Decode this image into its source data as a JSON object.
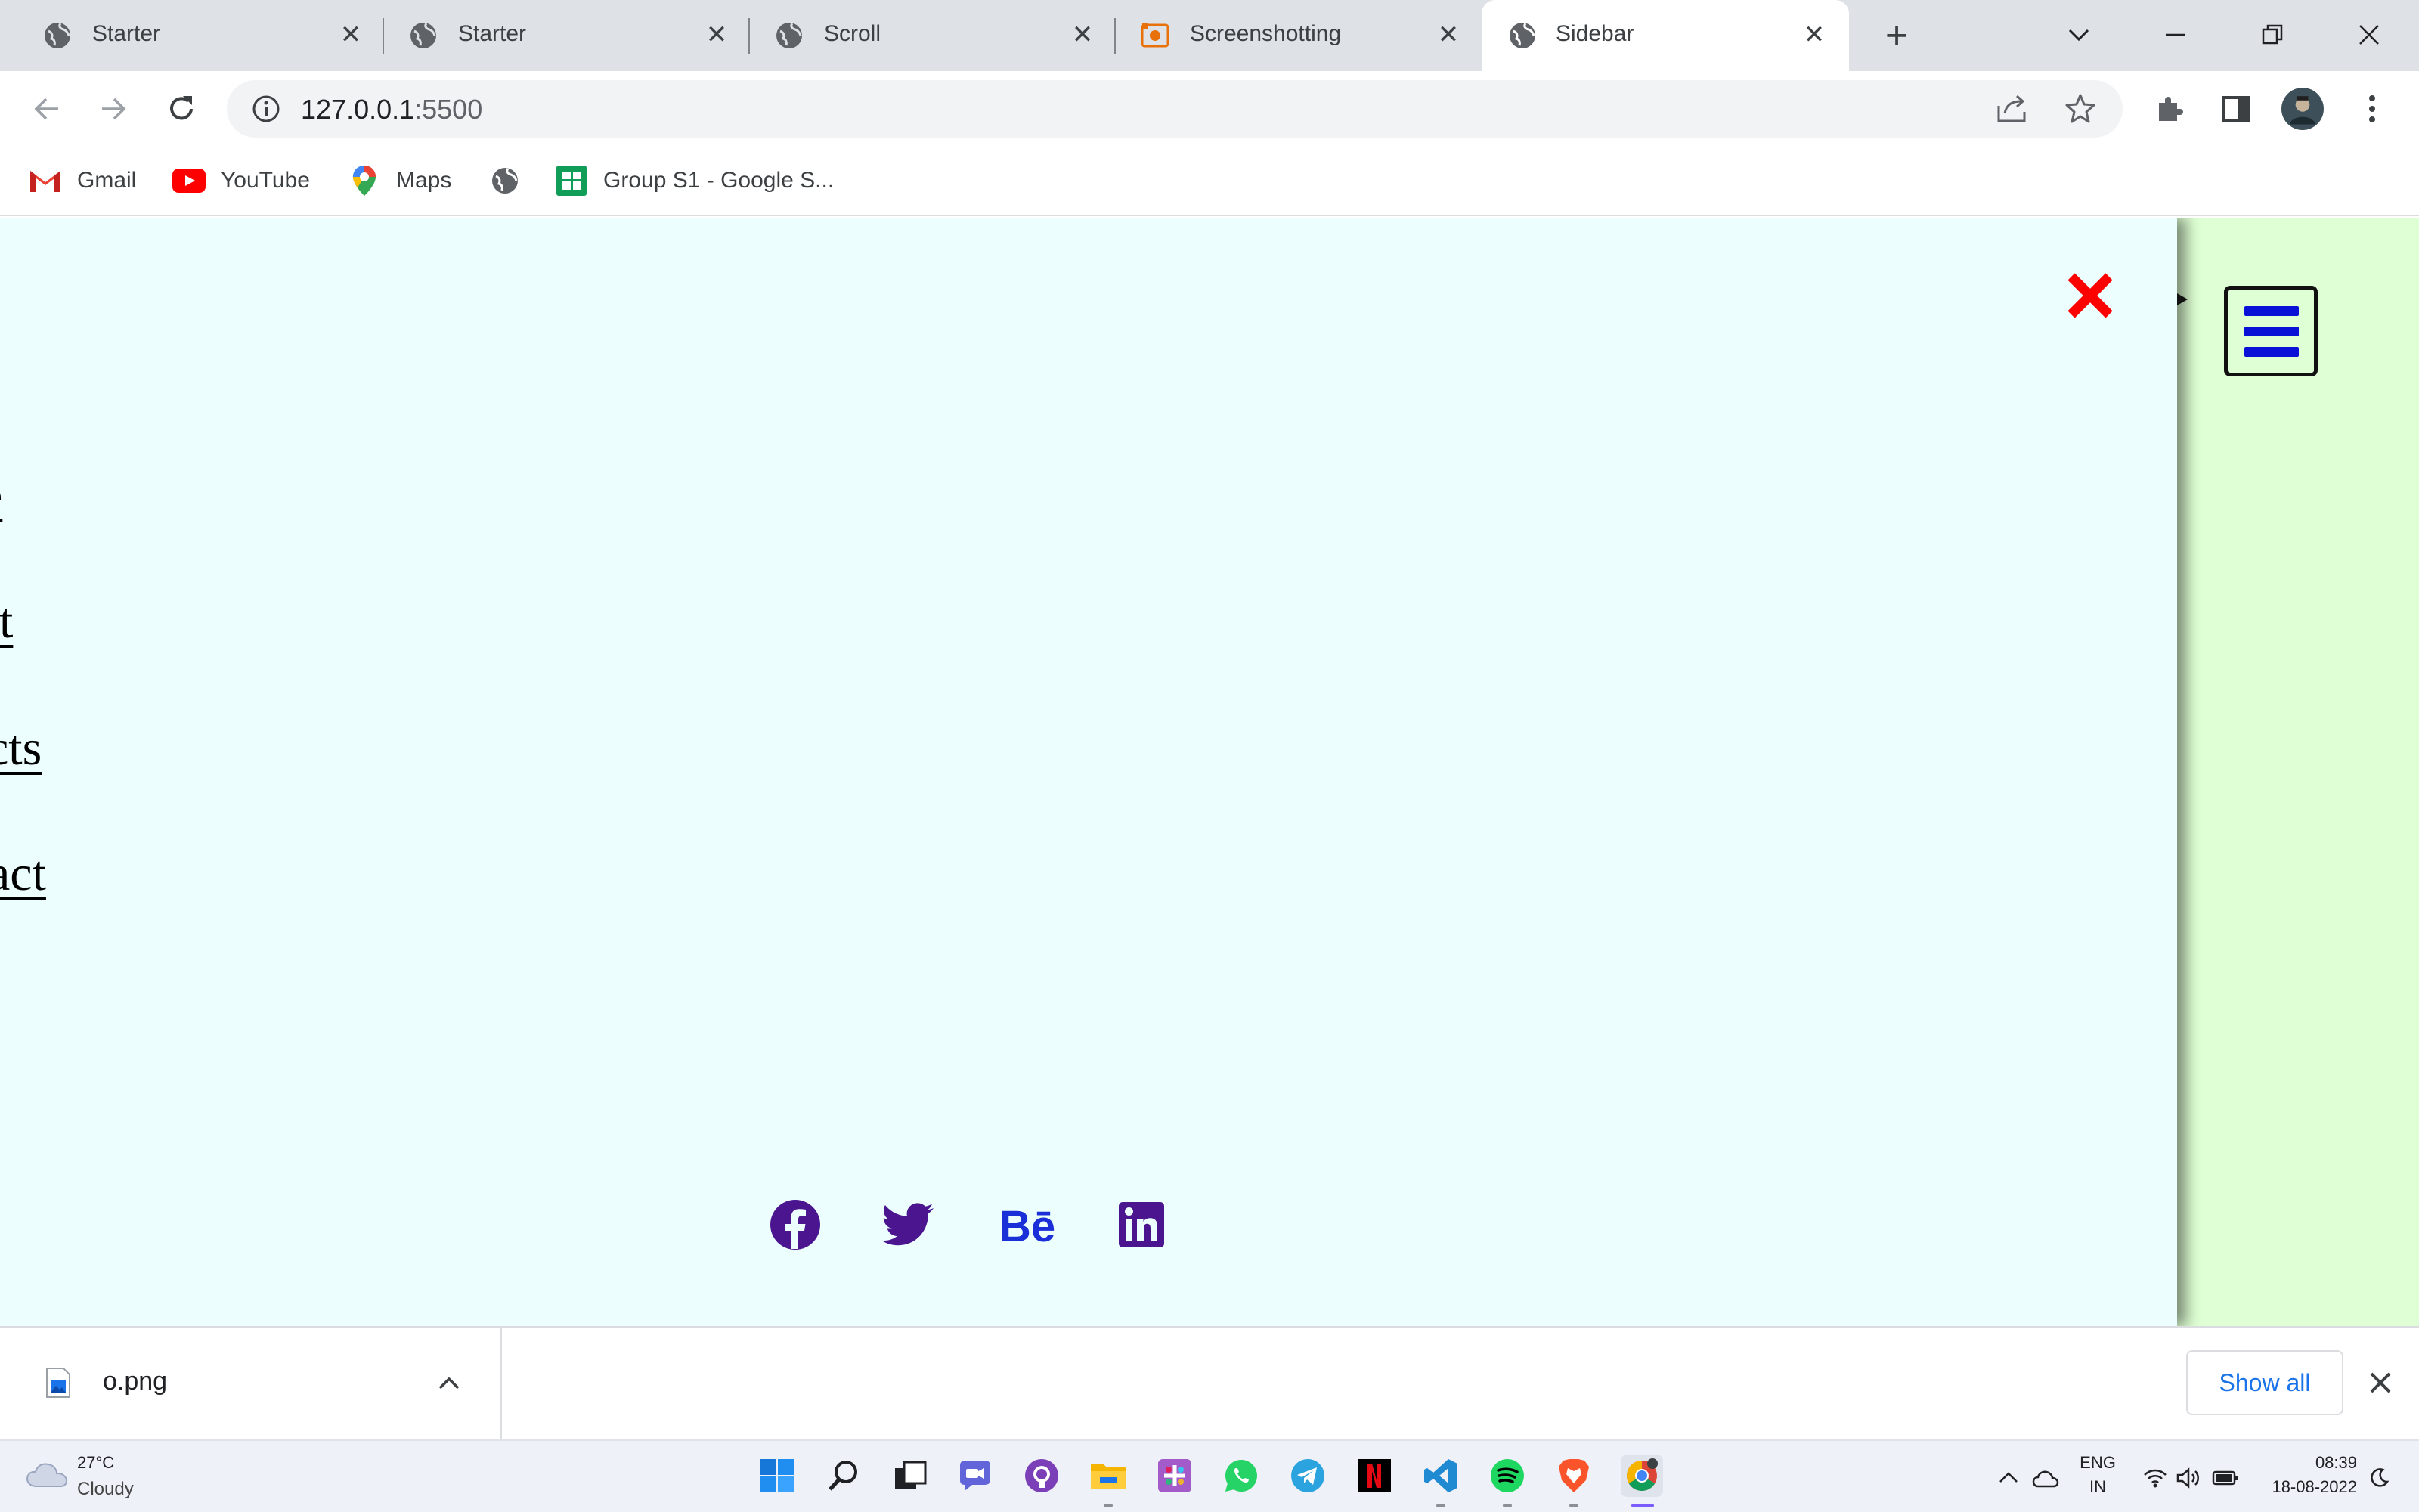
{
  "browser": {
    "tabs": [
      {
        "title": "Starter",
        "active": false
      },
      {
        "title": "Starter",
        "active": false
      },
      {
        "title": "Scroll",
        "active": false
      },
      {
        "title": "Screenshotting",
        "active": false
      },
      {
        "title": "Sidebar",
        "active": true
      }
    ],
    "new_tab_label": "+",
    "address": {
      "host": "127.0.0.1",
      "port": ":5500"
    },
    "bookmarks": [
      {
        "label": "Gmail",
        "icon": "gmail-icon"
      },
      {
        "label": "YouTube",
        "icon": "youtube-icon"
      },
      {
        "label": "Maps",
        "icon": "maps-icon"
      },
      {
        "label": "",
        "icon": "globe-icon"
      },
      {
        "label": "Group S1 - Google S...",
        "icon": "sheets-icon"
      }
    ]
  },
  "page": {
    "nav_links": [
      "e",
      "ut",
      "cts",
      "act"
    ],
    "social_icons": [
      "facebook-icon",
      "twitter-icon",
      "behance-icon",
      "linkedin-icon"
    ],
    "colors": {
      "sidebar_bg": "#ecfffe",
      "page_bg": "#dfffd4",
      "close_red": "#ff0000",
      "menu_blue": "#0a11d6",
      "social_purple": "#4b1590",
      "behance_blue": "#1b2fd8"
    }
  },
  "downloads": {
    "file_name": "o.png",
    "show_all_label": "Show all"
  },
  "taskbar": {
    "weather": {
      "temp": "27°C",
      "condition": "Cloudy"
    },
    "lang": {
      "line1": "ENG",
      "line2": "IN"
    },
    "clock": {
      "time": "08:39",
      "date": "18-08-2022"
    }
  }
}
